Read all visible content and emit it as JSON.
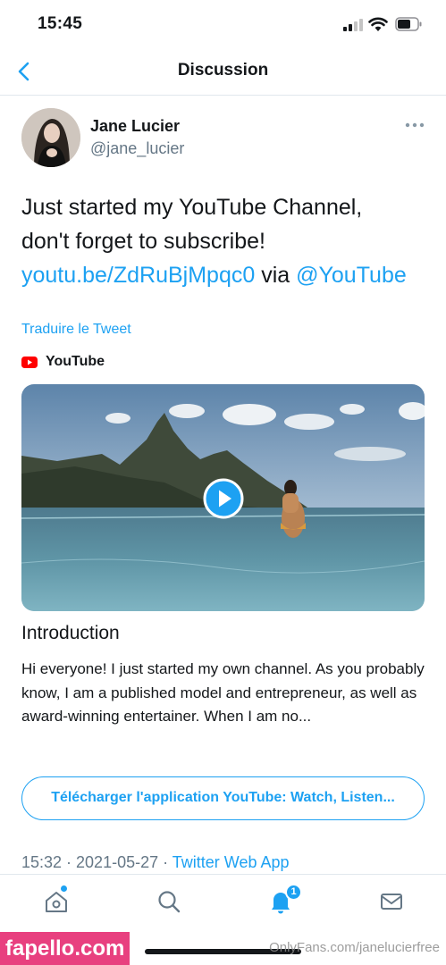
{
  "status_bar": {
    "time": "15:45"
  },
  "nav": {
    "title": "Discussion"
  },
  "tweet": {
    "display_name": "Jane Lucier",
    "username": "@jane_lucier",
    "text_line1": "Just started my YouTube Channel,",
    "text_line2": "don't forget to subscribe!",
    "link": "youtu.be/ZdRuBjMpqc0",
    "via": "via",
    "mention": "@YouTube",
    "translate": "Traduire le Tweet",
    "timestamp": "15:32 · 2021-05-27 ·",
    "source_app": "Twitter Web App"
  },
  "card": {
    "source_name": "YouTube",
    "title": "Introduction",
    "description": "Hi everyone! I just started my own channel. As you probably know, I am a published model and entrepreneur, as well as award-winning entertainer. When I am no...",
    "app_button": "Télécharger l'application YouTube: Watch, Listen..."
  },
  "tab_bar": {
    "items": [
      {
        "icon": "home-icon"
      },
      {
        "icon": "search-icon"
      },
      {
        "icon": "notifications-icon",
        "badge": "1"
      },
      {
        "icon": "messages-icon"
      }
    ]
  },
  "watermarks": {
    "left": "fapello.com",
    "right": "OnlyFans.com/janelucierfree"
  },
  "colors": {
    "accent": "#1da1f2",
    "text": "#14171a",
    "secondary": "#657786",
    "youtube_red": "#ff0000",
    "watermark": "#e8407f"
  }
}
